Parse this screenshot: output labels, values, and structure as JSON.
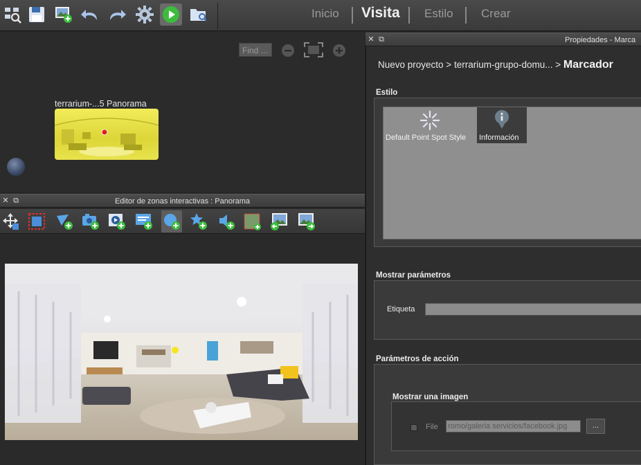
{
  "toolbar": {
    "nav": [
      "Inicio",
      "Visita",
      "Estilo",
      "Crear"
    ],
    "selected_nav": "Visita"
  },
  "map": {
    "find_placeholder": "Find ...",
    "node_label": "terrarium-...5 Panorama"
  },
  "hotspot_editor": {
    "title": "Editor de zonas interactivas : Panorama"
  },
  "properties": {
    "title": "Propiedades - Marca",
    "breadcrumb_path": "Nuevo proyecto > terrarium-grupo-domu... > ",
    "breadcrumb_current": "Marcador",
    "style_section": "Estilo",
    "styles": [
      {
        "label": "Default Point Spot Style",
        "selected": false
      },
      {
        "label": "Información",
        "selected": true
      }
    ],
    "display_section": "Mostrar parámetros",
    "label_field": "Etiqueta",
    "label_value": "",
    "action_section": "Parámetros de acción",
    "image_group": "Mostrar una imagen",
    "file_label": "File",
    "file_value": "romo/galeria servicios/facebook.jpg",
    "browse_label": "..."
  },
  "colors": {
    "accent_green": "#3cbc3c",
    "node_yellow": "#e6df45",
    "pin_red": "#e02020"
  }
}
